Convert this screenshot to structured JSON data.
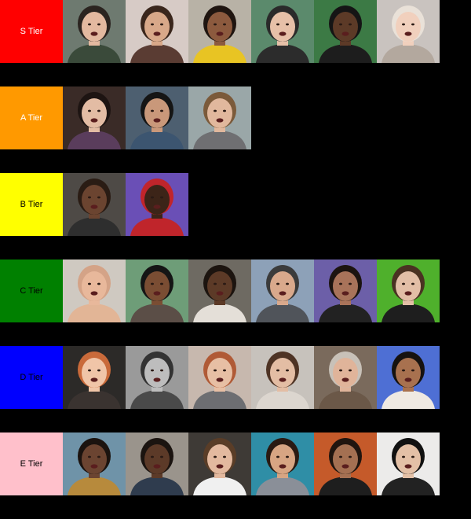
{
  "tiers": [
    {
      "label": "S Tier",
      "color": "#ff0000",
      "text_color": "#ffffff",
      "tiles": [
        {
          "name": "reaction-tile-headphones-man",
          "bg": "#6e7a70",
          "skin": "#e3b9a0",
          "hair": "#2b2420",
          "shirt": "#3a4a3a"
        },
        {
          "name": "reaction-tile-woman-hands-face",
          "bg": "#d7cbc6",
          "skin": "#d8a889",
          "hair": "#3a261c",
          "shirt": "#5a3c33"
        },
        {
          "name": "reaction-tile-girl-yellow-shirt",
          "bg": "#b8b2a6",
          "skin": "#8c5a3e",
          "hair": "#1f1510",
          "shirt": "#e8c423"
        },
        {
          "name": "reaction-tile-man-beanie",
          "bg": "#5b8a6c",
          "skin": "#e6c0a8",
          "hair": "#2a2a2a",
          "shirt": "#2c2c2c"
        },
        {
          "name": "reaction-tile-man-headset",
          "bg": "#3c7a45",
          "skin": "#5c3a27",
          "hair": "#151515",
          "shirt": "#1d1d1d"
        },
        {
          "name": "reaction-tile-woman-hijab",
          "bg": "#c9c3bf",
          "skin": "#f1d0bd",
          "hair": "#e9e1d8",
          "shirt": "#b3a89e"
        }
      ]
    },
    {
      "label": "A Tier",
      "color": "#ff9900",
      "text_color": "#ffffff",
      "tiles": [
        {
          "name": "reaction-tile-man-glasses-laughing",
          "bg": "#3a2b27",
          "skin": "#e3bca4",
          "hair": "#1d1412",
          "shirt": "#5a3d5c"
        },
        {
          "name": "reaction-tile-older-man",
          "bg": "#4d5f70",
          "skin": "#c9987a",
          "hair": "#151515",
          "shirt": "#3c5570"
        },
        {
          "name": "reaction-tile-woman-curly-hair",
          "bg": "#9aa7a8",
          "skin": "#e1b89d",
          "hair": "#7b5a3a",
          "shirt": "#6f6f72"
        }
      ]
    },
    {
      "label": "B Tier",
      "color": "#ffff00",
      "text_color": "#000000",
      "tiles": [
        {
          "name": "reaction-tile-smiling-man",
          "bg": "#4e4a46",
          "skin": "#6b4430",
          "hair": "#2a1c14",
          "shirt": "#2e2e2e"
        },
        {
          "name": "reaction-tile-kid-red-hoodie",
          "bg": "#6a4fb6",
          "skin": "#3c2418",
          "hair": "#c0252b",
          "shirt": "#c0252b"
        }
      ]
    },
    {
      "label": "C Tier",
      "color": "#008000",
      "text_color": "#000000",
      "tiles": [
        {
          "name": "reaction-tile-baby",
          "bg": "#cfc9c1",
          "skin": "#e8b89b",
          "hair": "#d4a387",
          "shirt": "#e2b596"
        },
        {
          "name": "reaction-tile-person-headphones-glasses",
          "bg": "#6e9d78",
          "skin": "#7a4d33",
          "hair": "#151515",
          "shirt": "#5b4e47"
        },
        {
          "name": "reaction-tile-girl-laughing",
          "bg": "#6e6a62",
          "skin": "#5c3a27",
          "hair": "#1c140f",
          "shirt": "#e4dfd8"
        },
        {
          "name": "reaction-tile-woman-cap-outdoors",
          "bg": "#8da1b8",
          "skin": "#d9a98c",
          "hair": "#3b3b3b",
          "shirt": "#50545a"
        },
        {
          "name": "reaction-tile-man-hands-on-face",
          "bg": "#6c5fa8",
          "skin": "#a8735a",
          "hair": "#1c1410",
          "shirt": "#222222"
        },
        {
          "name": "reaction-tile-woman-green-screen",
          "bg": "#4fb02c",
          "skin": "#e2bea6",
          "hair": "#4a3222",
          "shirt": "#1e1e1e"
        }
      ]
    },
    {
      "label": "D Tier",
      "color": "#0000ff",
      "text_color": "#000000",
      "tiles": [
        {
          "name": "reaction-tile-woman-grimace",
          "bg": "#2c2a28",
          "skin": "#f0c5a8",
          "hair": "#c96a3a",
          "shirt": "#3a3330"
        },
        {
          "name": "reaction-tile-man-bw-laughing",
          "bg": "#9a9a9a",
          "skin": "#bdbdbd",
          "hair": "#333333",
          "shirt": "#4a4a4a"
        },
        {
          "name": "reaction-tile-redhead-woman",
          "bg": "#c7b8ae",
          "skin": "#e7bfa4",
          "hair": "#b05a36",
          "shirt": "#6d6e72"
        },
        {
          "name": "reaction-tile-woman-laughing-bedroom",
          "bg": "#c7c2bc",
          "skin": "#e3bda4",
          "hair": "#4e3324",
          "shirt": "#dcd6cf"
        },
        {
          "name": "reaction-tile-older-man-beard",
          "bg": "#7a6a5c",
          "skin": "#e0b49a",
          "hair": "#c8c1b8",
          "shirt": "#6b5848"
        },
        {
          "name": "reaction-tile-smiling-young-man",
          "bg": "#4e6fd4",
          "skin": "#a8714f",
          "hair": "#161210",
          "shirt": "#efe9e2"
        }
      ]
    },
    {
      "label": "E Tier",
      "color": "#ffc0cb",
      "text_color": "#000000",
      "tiles": [
        {
          "name": "reaction-tile-woman-leopard-top",
          "bg": "#6f93a8",
          "skin": "#6b4431",
          "hair": "#1b130f",
          "shirt": "#b78a3c"
        },
        {
          "name": "reaction-tile-kid-smiling",
          "bg": "#9a948c",
          "skin": "#5c3a28",
          "hair": "#1b1410",
          "shirt": "#2f3c4e"
        },
        {
          "name": "reaction-tile-basketball-player",
          "bg": "#3e3a36",
          "skin": "#e3b99f",
          "hair": "#5a3d27",
          "shirt": "#f0f0f0"
        },
        {
          "name": "reaction-tile-girl-teal-background",
          "bg": "#2f8ea6",
          "skin": "#d7a583",
          "hair": "#2a1a12",
          "shirt": "#8a8f98"
        },
        {
          "name": "reaction-tile-woman-hoop-earrings",
          "bg": "#c55a2a",
          "skin": "#a47052",
          "hair": "#20150f",
          "shirt": "#1e1e1e"
        },
        {
          "name": "reaction-tile-man-black-cap",
          "bg": "#ecebea",
          "skin": "#e3c0a6",
          "hair": "#111111",
          "shirt": "#222222"
        }
      ]
    }
  ]
}
